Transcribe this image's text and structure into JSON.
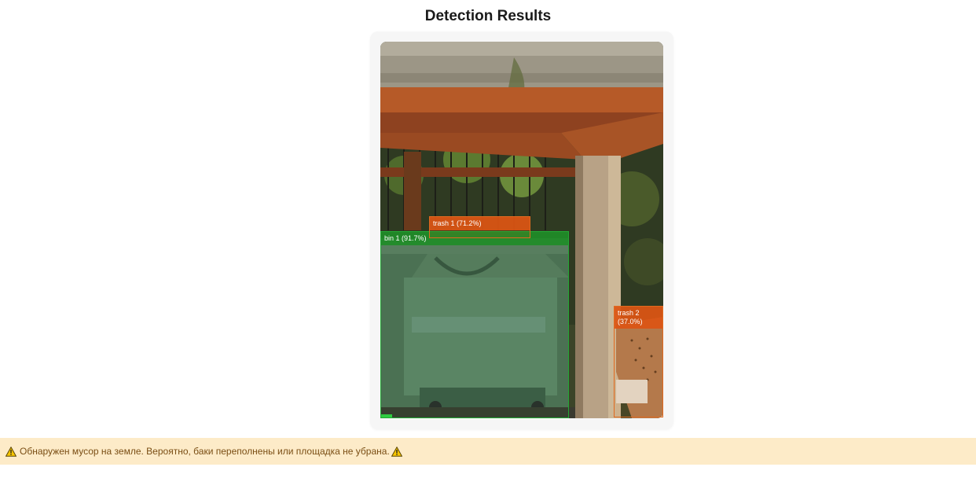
{
  "header": {
    "title": "Detection Results"
  },
  "detections": [
    {
      "label": "bin 1 (91.7%)",
      "color": "#22a834"
    },
    {
      "label": "trash 1 (71.2%)",
      "color": "#e06a20"
    },
    {
      "label": "trash 2\n(37.0%)",
      "color": "#e06a20"
    }
  ],
  "alert": {
    "message": "Обнаружен мусор на земле. Вероятно, баки переполнены или площадка не убрана.",
    "icon": "warning-icon",
    "background": "#fdebc8",
    "text_color": "#7a4e14"
  }
}
